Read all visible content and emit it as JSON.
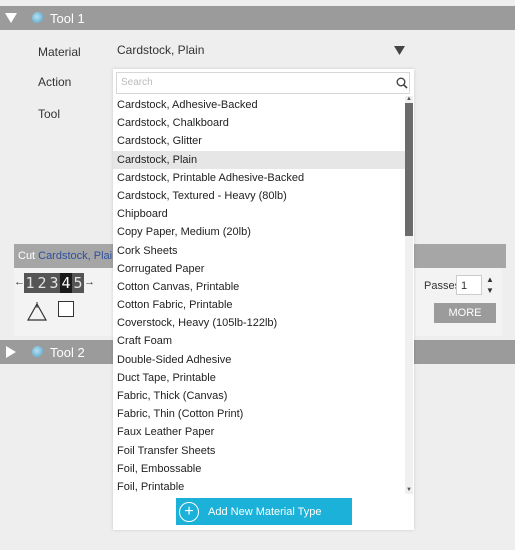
{
  "tool1": {
    "title": "Tool 1"
  },
  "tool2": {
    "title": "Tool 2"
  },
  "panel": {
    "material_label": "Material",
    "action_label": "Action",
    "tool_label": "Tool",
    "material_value": "Cardstock, Plain"
  },
  "cut": {
    "prefix": "Cut",
    "material": "Cardstock, Plain",
    "digits": [
      "1",
      "2",
      "3",
      "4",
      "5"
    ],
    "active_digit_index": 3,
    "passes_label": "Passes",
    "passes_value": "1",
    "more_label": "MORE"
  },
  "dropdown": {
    "search_placeholder": "Search",
    "selected_index": 3,
    "items": [
      "Cardstock, Adhesive-Backed",
      "Cardstock, Chalkboard",
      "Cardstock, Glitter",
      "Cardstock, Plain",
      "Cardstock, Printable Adhesive-Backed",
      "Cardstock, Textured - Heavy (80lb)",
      "Chipboard",
      "Copy Paper, Medium (20lb)",
      "Cork Sheets",
      "Corrugated Paper",
      "Cotton Canvas, Printable",
      "Cotton Fabric, Printable",
      "Coverstock, Heavy (105lb-122lb)",
      "Craft Foam",
      "Double-Sided Adhesive",
      "Duct Tape, Printable",
      "Fabric, Thick (Canvas)",
      "Fabric, Thin (Cotton Print)",
      "Faux Leather Paper",
      "Foil Transfer Sheets",
      "Foil, Embossable",
      "Foil, Printable"
    ],
    "add_button_label": "Add New Material Type"
  },
  "colors": {
    "header_gray": "#9b9b9b",
    "accent_blue": "#1bb1d8",
    "material_link": "#2d4f9e"
  }
}
